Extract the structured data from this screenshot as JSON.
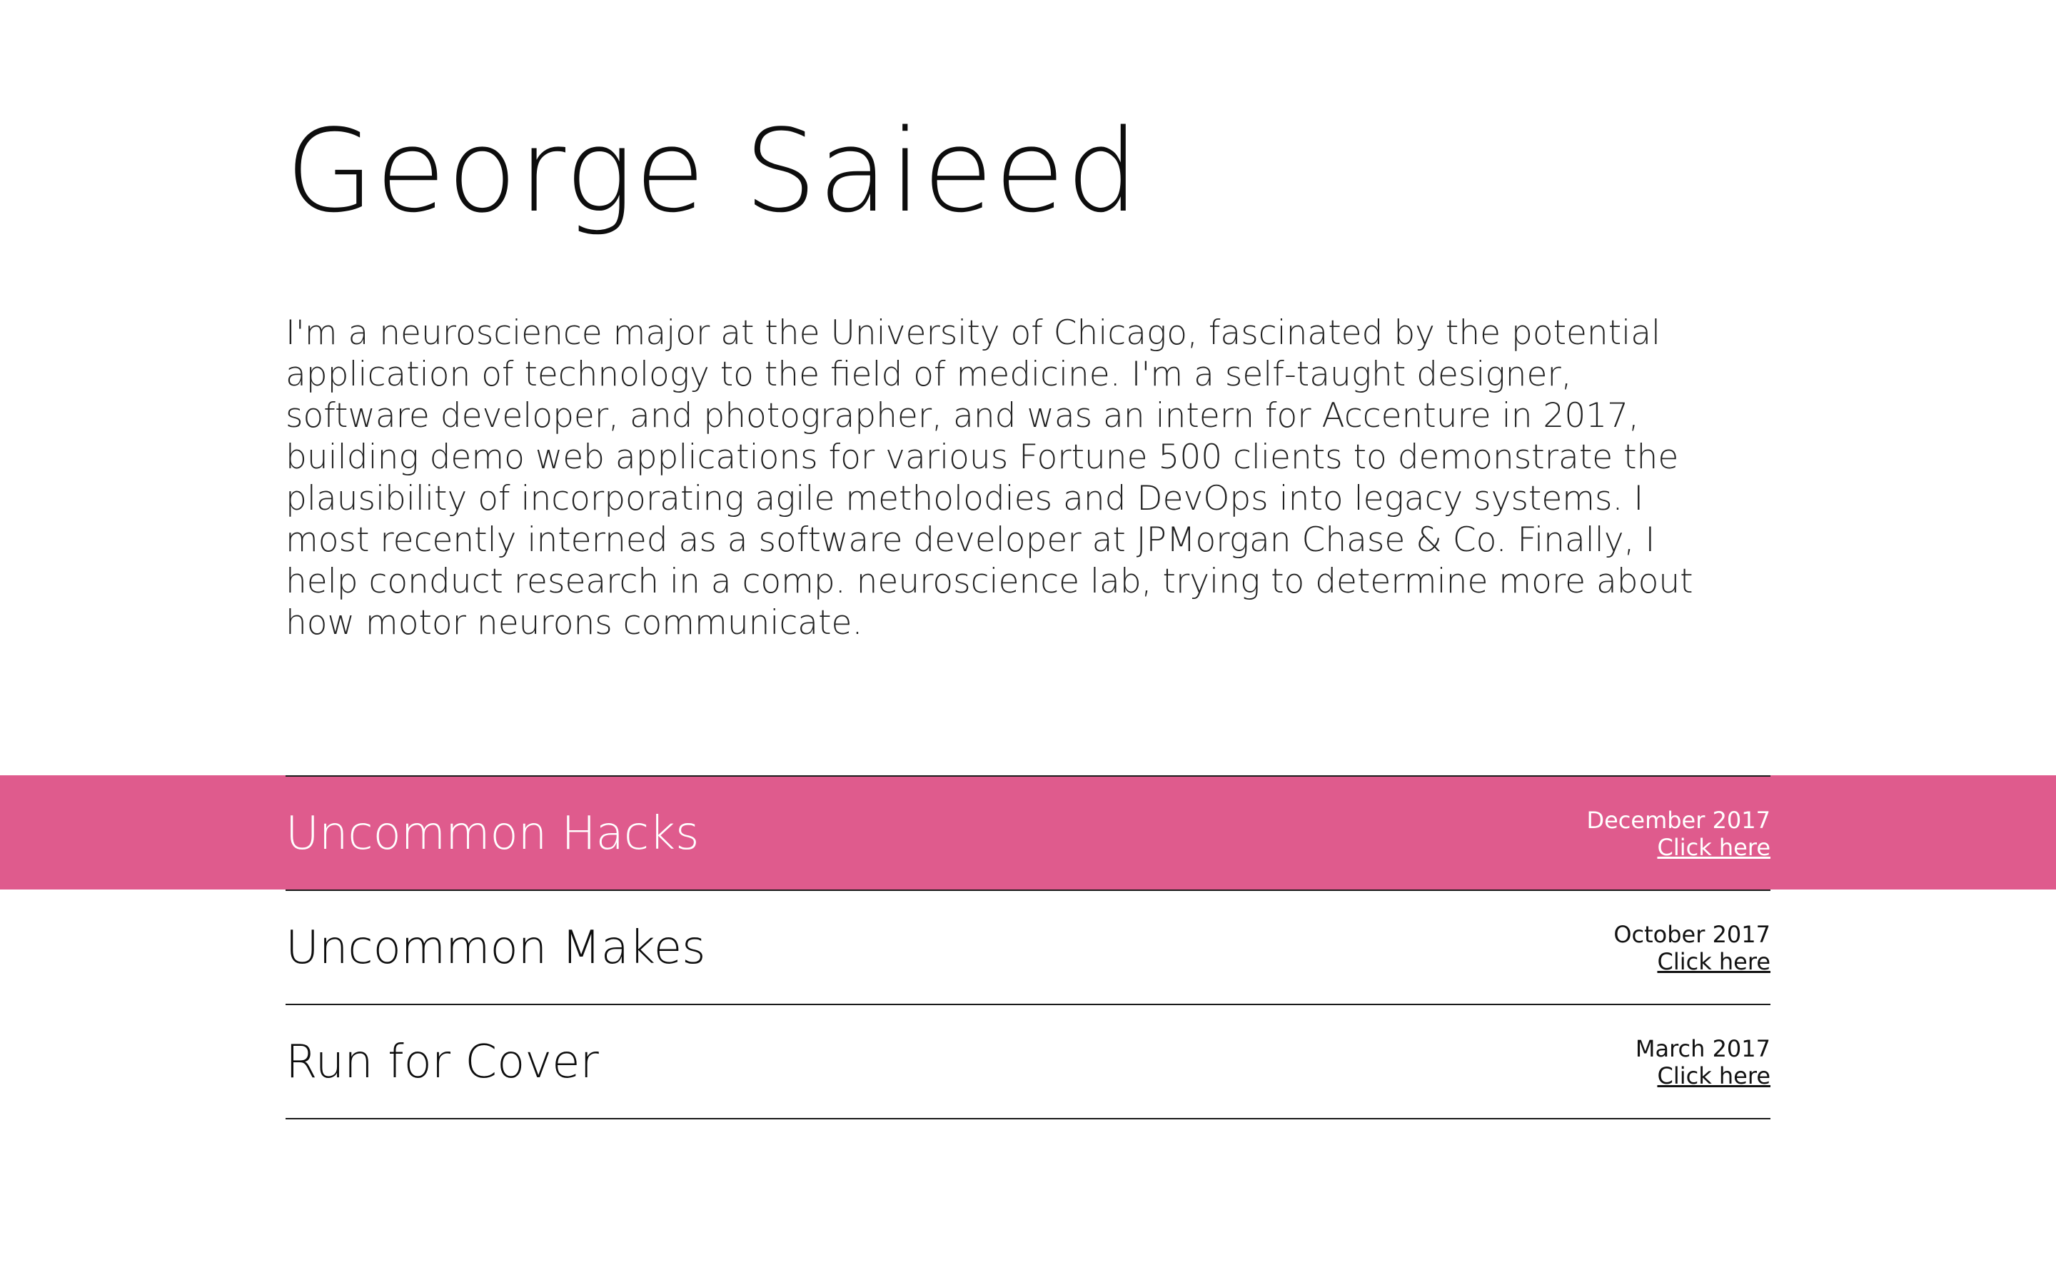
{
  "profile": {
    "name": "George Saieed",
    "bio": "I'm a neuroscience major at the University of Chicago, fascinated by the potential application of technology to the field of medicine. I'm a self-taught designer, software developer, and photographer, and was an intern for Accenture in 2017, building demo web applications for various Fortune 500 clients to demonstrate the plausibility of incorporating agile metholodies and DevOps into legacy systems. I most recently interned as a software developer at JPMorgan Chase & Co. Finally, I help conduct research in a comp. neuroscience lab, trying to determine more about how motor neurons communicate."
  },
  "projects": [
    {
      "title": "Uncommon Hacks",
      "date": "December 2017",
      "link_label": "Click here",
      "highlighted": true
    },
    {
      "title": "Uncommon Makes",
      "date": "October 2017",
      "link_label": "Click here",
      "highlighted": false
    },
    {
      "title": "Run for Cover",
      "date": "March 2017",
      "link_label": "Click here",
      "highlighted": false
    }
  ],
  "colors": {
    "highlight": "#df5b8d",
    "text": "#111111",
    "background": "#ffffff"
  }
}
